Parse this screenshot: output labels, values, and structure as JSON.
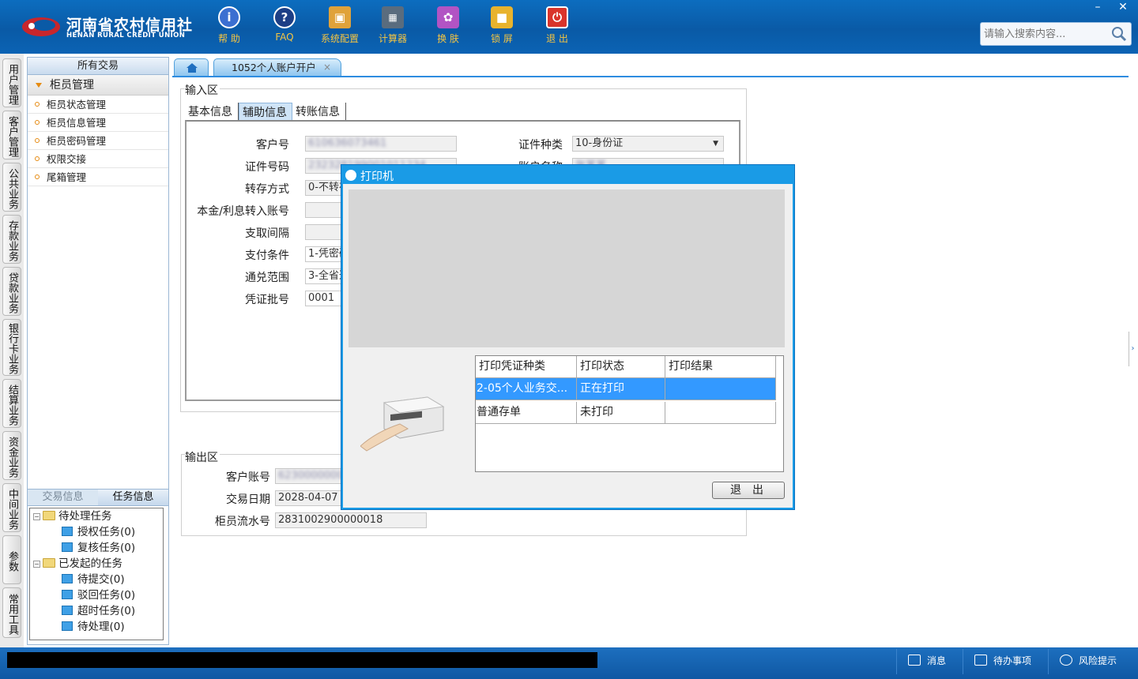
{
  "brand": {
    "name_cn": "河南省农村信用社",
    "name_en": "HENAN RURAL CREDIT UNION"
  },
  "toolbar": [
    {
      "label": "帮 助",
      "icon": "info-icon",
      "color": "#3b6fd1"
    },
    {
      "label": "FAQ",
      "icon": "question-icon",
      "color": "#1d3f86"
    },
    {
      "label": "系统配置",
      "icon": "toolbox-icon",
      "color": "#e0a23a"
    },
    {
      "label": "计算器",
      "icon": "calculator-icon",
      "color": "#5a6c7e"
    },
    {
      "label": "换 肤",
      "icon": "shirt-icon",
      "color": "#b254c4"
    },
    {
      "label": "锁 屏",
      "icon": "lock-icon",
      "color": "#e8b32d"
    },
    {
      "label": "退 出",
      "icon": "power-icon",
      "color": "#d9342b"
    }
  ],
  "search": {
    "placeholder": "请输入搜索内容..."
  },
  "left_rail": [
    "用户管理",
    "客户管理",
    "公共业务",
    "存款业务",
    "贷款业务",
    "银行卡业务",
    "结算业务",
    "资金业务",
    "中间业务",
    "参数",
    "常用工具"
  ],
  "nav": {
    "header": "所有交易",
    "group": "柜员管理",
    "items": [
      "柜员状态管理",
      "柜员信息管理",
      "柜员密码管理",
      "权限交接",
      "尾箱管理"
    ]
  },
  "task_tabs": [
    "交易信息",
    "任务信息"
  ],
  "task_tree": {
    "pending": "待处理任务",
    "pending_children": [
      "授权任务(0)",
      "复核任务(0)"
    ],
    "initiated": "已发起的任务",
    "initiated_children": [
      "待提交(0)",
      "驳回任务(0)",
      "超时任务(0)",
      "待处理(0)"
    ]
  },
  "tabs": {
    "active": "1052个人账户开户",
    "close": "×"
  },
  "input_area": {
    "title": "输入区",
    "subtabs": [
      "基本信息",
      "辅助信息",
      "转账信息"
    ],
    "fields": {
      "customer_no_label": "客户号",
      "customer_no": "610636073461",
      "id_no_label": "证件号码",
      "id_no": "232328199001011234",
      "deposit_mode_label": "转存方式",
      "deposit_mode": "0-不转存",
      "interest_acct_label": "本金/利息转入账号",
      "interest_acct": "",
      "withdraw_interval_label": "支取间隔",
      "withdraw_interval": "",
      "pay_cond_label": "支付条件",
      "pay_cond": "1-凭密码",
      "exchange_scope_label": "通兑范围",
      "exchange_scope": "3-全省通兑",
      "voucher_batch_label": "凭证批号",
      "voucher_batch": "0001",
      "id_type_label": "证件种类",
      "id_type": "10-身份证",
      "acct_name_label": "账户名称",
      "acct_name": "张某某"
    }
  },
  "output_area": {
    "title": "输出区",
    "cust_acct_label": "客户账号",
    "cust_acct": "6230000000000000",
    "txn_date_label": "交易日期",
    "txn_date": "2028-04-07",
    "teller_serial_label": "柜员流水号",
    "teller_serial": "2831002900000018"
  },
  "dialog": {
    "title": "打印机",
    "columns": [
      "打印凭证种类",
      "打印状态",
      "打印结果"
    ],
    "rows": [
      {
        "kind": "2-05个人业务交...",
        "status": "正在打印",
        "result": ""
      },
      {
        "kind": "普通存单",
        "status": "未打印",
        "result": ""
      }
    ],
    "exit_label": "退出"
  },
  "statusbar": {
    "msg": "消息",
    "todo": "待办事项",
    "risk": "风险提示"
  },
  "window": {
    "min": "–",
    "close": "✕"
  }
}
